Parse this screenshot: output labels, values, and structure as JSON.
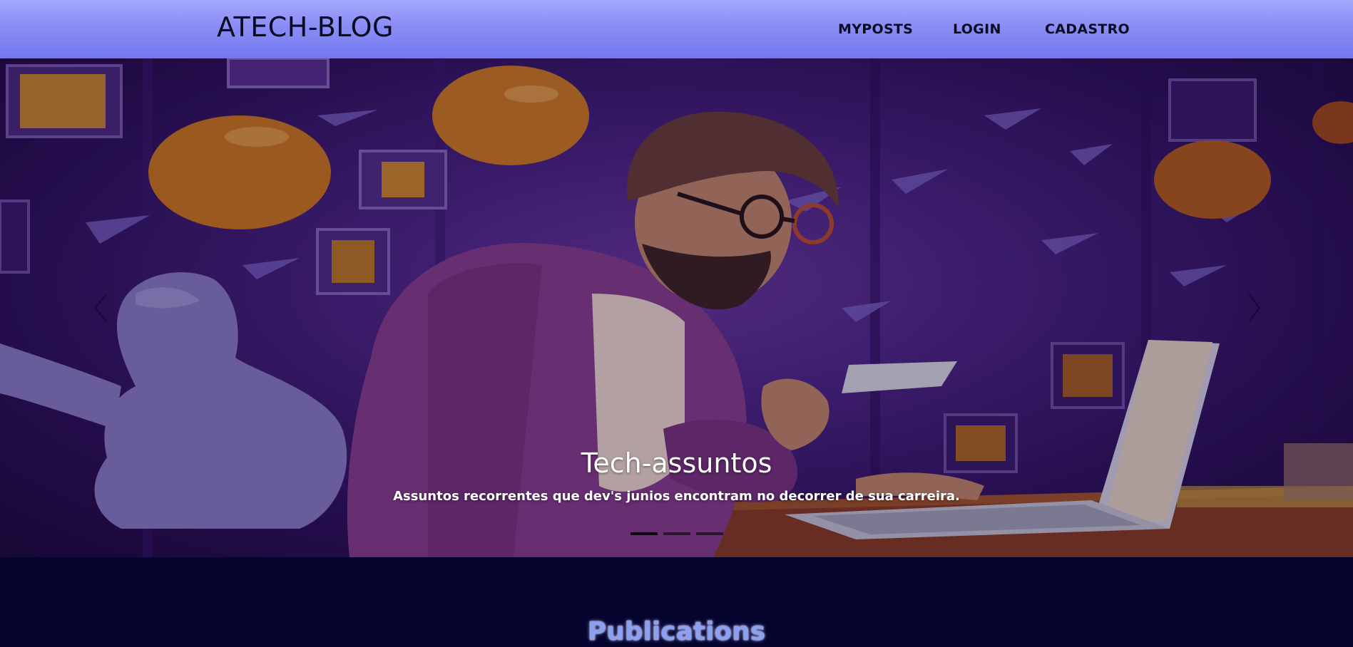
{
  "navbar": {
    "brand": "ATECH-BLOG",
    "links": [
      "MYPOSTS",
      "LOGIN",
      "CADASTRO"
    ]
  },
  "carousel": {
    "caption_title": "Tech-assuntos",
    "caption_text": "Assuntos recorrentes que dev's junios encontram no decorrer de sua carreira.",
    "slide_count": 3,
    "active_slide": 1,
    "prev_icon": "chevron-left-icon",
    "next_icon": "chevron-right-icon"
  },
  "publications": {
    "title": "Publications"
  },
  "colors": {
    "navbar_top": "#a3a6fb",
    "navbar_bottom": "#7478f0",
    "page_background": "#04042e",
    "publications_title": "#8aa0f0"
  }
}
